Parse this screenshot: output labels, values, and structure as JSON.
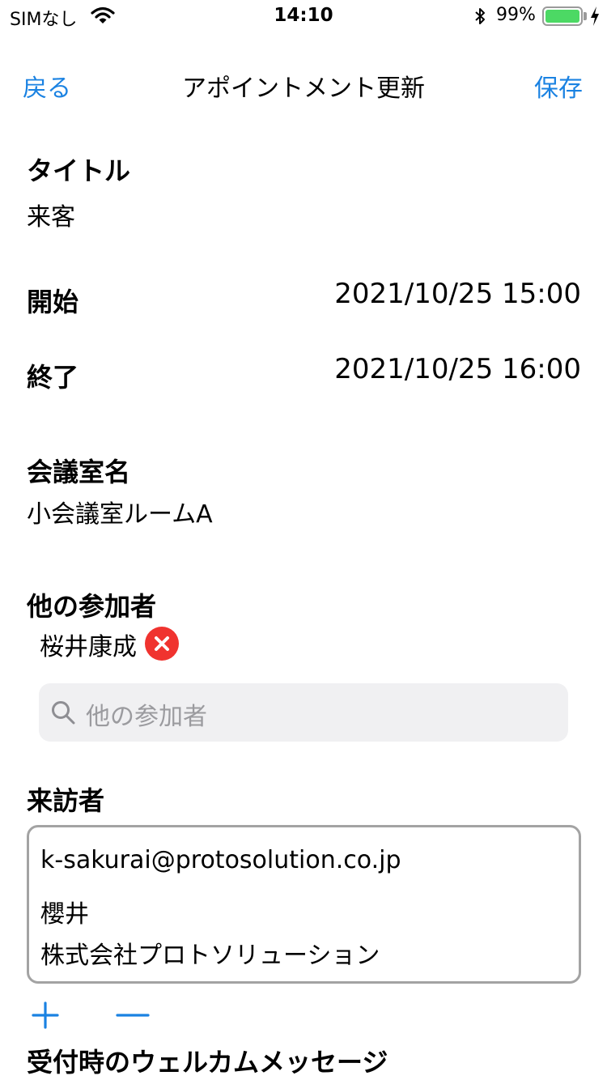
{
  "status_bar": {
    "carrier": "SIMなし",
    "time": "14:10",
    "battery_percent": "99%"
  },
  "nav": {
    "back": "戻る",
    "title": "アポイントメント更新",
    "save": "保存"
  },
  "form": {
    "title_label": "タイトル",
    "title_value": "来客",
    "start_label": "開始",
    "start_value": "2021/10/25  15:00",
    "end_label": "終了",
    "end_value": "2021/10/25  16:00",
    "room_label": "会議室名",
    "room_value": "小会議室ルームA",
    "participants_label": "他の参加者",
    "participants": [
      "桜井康成"
    ],
    "participants_search_placeholder": "他の参加者",
    "visitor_label": "来訪者",
    "visitor": {
      "email": "k-sakurai@protosolution.co.jp",
      "name": "櫻井",
      "company": "株式会社プロトソリューション"
    },
    "welcome_label": "受付時のウェルカムメッセージ"
  },
  "colors": {
    "accent": "#1a82e2",
    "remove_chip": "#f0332f",
    "battery": "#4cd964"
  },
  "icons": [
    "wifi-icon",
    "bluetooth-icon",
    "battery-icon",
    "charging-icon",
    "remove-icon",
    "search-icon",
    "add-icon",
    "minus-icon"
  ]
}
